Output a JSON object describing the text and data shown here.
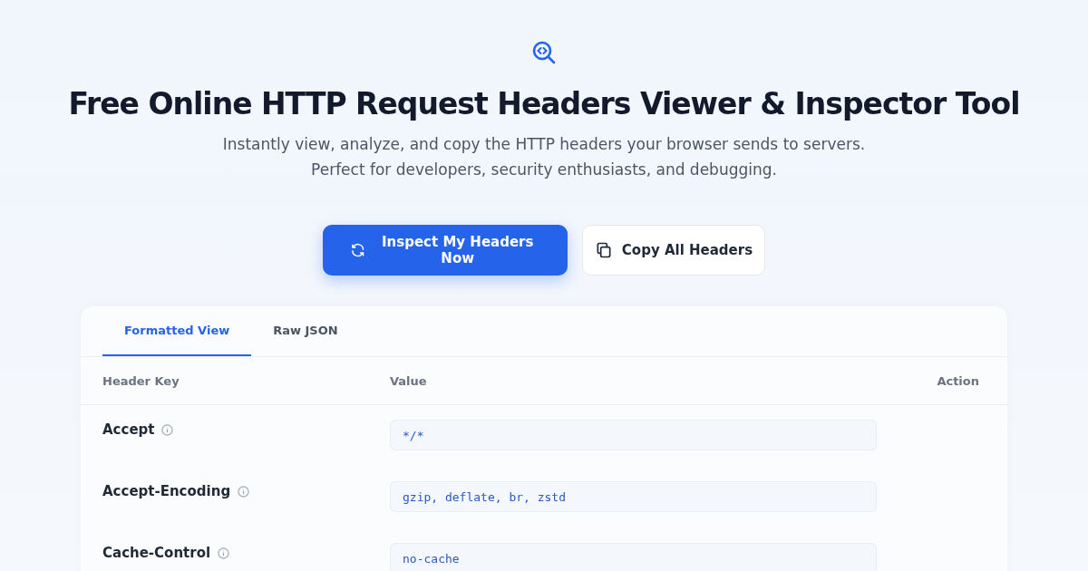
{
  "title": "Free Online HTTP Request Headers Viewer & Inspector Tool",
  "subtitle_lines": [
    "Instantly view, analyze, and copy the HTTP headers your browser sends to servers.",
    "Perfect for developers, security enthusiasts, and debugging."
  ],
  "buttons": [
    {
      "label": "Inspect My Headers Now",
      "kind": "primary"
    },
    {
      "label": "Copy All Headers",
      "kind": "secondary"
    }
  ],
  "tabs": [
    {
      "label": "Formatted View",
      "selected": true
    },
    {
      "label": "Raw JSON",
      "selected": false
    }
  ],
  "table": {
    "columns": [
      "Header Key",
      "Value",
      "Action"
    ],
    "rows": [
      {
        "key": "Accept",
        "value": "*/*"
      },
      {
        "key": "Accept-Encoding",
        "value": "gzip, deflate, br, zstd"
      },
      {
        "key": "Cache-Control",
        "value": "no-cache"
      }
    ]
  }
}
